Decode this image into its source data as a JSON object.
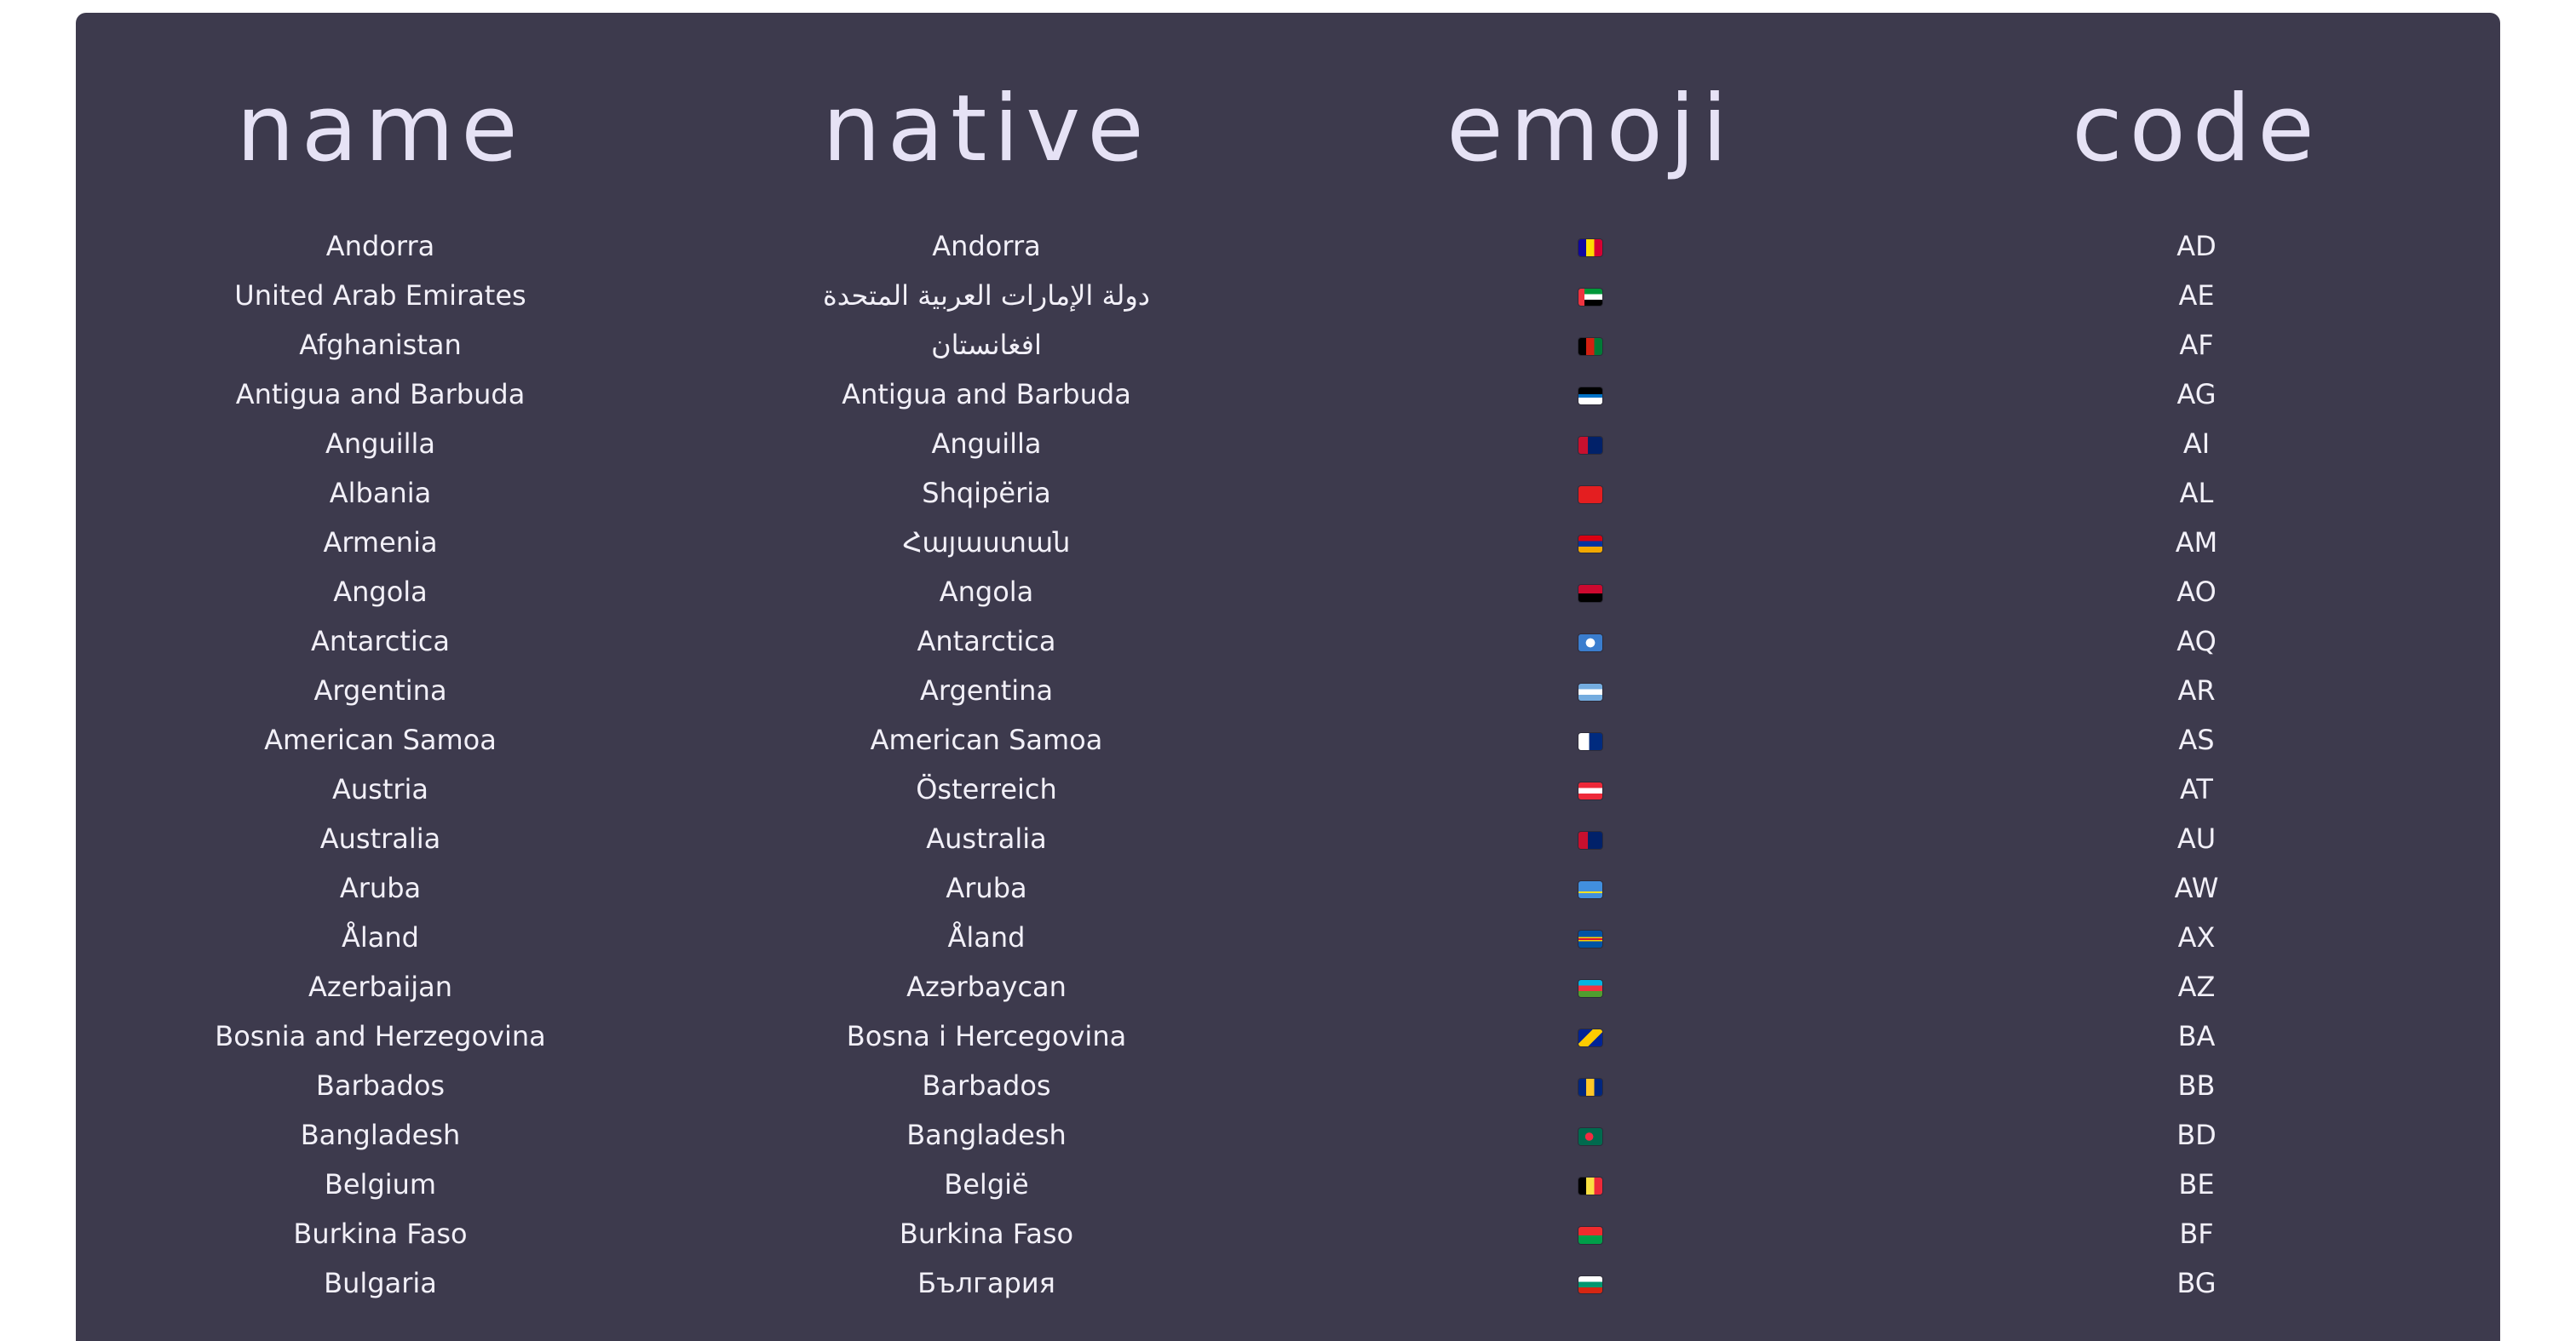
{
  "table": {
    "headers": [
      "name",
      "native",
      "emoji",
      "code"
    ],
    "rows": [
      {
        "name": "Andorra",
        "native": "Andorra",
        "code": "AD",
        "flag": "flag-ad",
        "flag_css": "linear-gradient(90deg,#10069f 33%,#fedd00 33% 66%,#d50032 66%)"
      },
      {
        "name": "United Arab Emirates",
        "native": "دولة الإمارات العربية المتحدة",
        "code": "AE",
        "flag": "flag-ae",
        "flag_css": "linear-gradient(90deg,#ef3340 25%,transparent 25%),linear-gradient(180deg,#009739 33%,#ffffff 33% 66%,#000000 66%)"
      },
      {
        "name": "Afghanistan",
        "native": "افغانستان",
        "code": "AF",
        "flag": "flag-af",
        "flag_css": "linear-gradient(90deg,#000000 33%,#d32011 33% 66%,#007a36 66%)"
      },
      {
        "name": "Antigua and Barbuda",
        "native": "Antigua and Barbuda",
        "code": "AG",
        "flag": "flag-ag",
        "flag_css": "linear-gradient(180deg,#000000 40%,#0072c6 40% 60%,#ffffff 60%)"
      },
      {
        "name": "Anguilla",
        "native": "Anguilla",
        "code": "AI",
        "flag": "flag-ai",
        "flag_css": "linear-gradient(90deg,#c8102e 40%,#012169 40%)"
      },
      {
        "name": "Albania",
        "native": "Shqipëria",
        "code": "AL",
        "flag": "flag-al",
        "flag_css": "linear-gradient(#e41e20,#e41e20)"
      },
      {
        "name": "Armenia",
        "native": "Հայաստան",
        "code": "AM",
        "flag": "flag-am",
        "flag_css": "linear-gradient(180deg,#d90012 33%,#0033a0 33% 66%,#f2a800 66%)"
      },
      {
        "name": "Angola",
        "native": "Angola",
        "code": "AO",
        "flag": "flag-ao",
        "flag_css": "linear-gradient(180deg,#cc092f 50%,#000000 50%)"
      },
      {
        "name": "Antarctica",
        "native": "Antarctica",
        "code": "AQ",
        "flag": "flag-aq",
        "flag_css": "radial-gradient(circle,#ffffff 30%,#3a7dce 32%)"
      },
      {
        "name": "Argentina",
        "native": "Argentina",
        "code": "AR",
        "flag": "flag-ar",
        "flag_css": "linear-gradient(180deg,#74acdf 33%,#ffffff 33% 66%,#74acdf 66%)"
      },
      {
        "name": "American Samoa",
        "native": "American Samoa",
        "code": "AS",
        "flag": "flag-as",
        "flag_css": "linear-gradient(90deg,#ffffff 45%,#002b7f 45%)"
      },
      {
        "name": "Austria",
        "native": "Österreich",
        "code": "AT",
        "flag": "flag-at",
        "flag_css": "linear-gradient(180deg,#ed2939 33%,#ffffff 33% 66%,#ed2939 66%)"
      },
      {
        "name": "Australia",
        "native": "Australia",
        "code": "AU",
        "flag": "flag-au",
        "flag_css": "linear-gradient(90deg,#c8102e 40%,#012169 40%)"
      },
      {
        "name": "Aruba",
        "native": "Aruba",
        "code": "AW",
        "flag": "flag-aw",
        "flag_css": "linear-gradient(180deg,#418fde 60%,#fbe122 60% 70%,#418fde 70%)"
      },
      {
        "name": "Åland",
        "native": "Åland",
        "code": "AX",
        "flag": "flag-ax",
        "flag_css": "linear-gradient(180deg,#0053a5 38%,#ffce00 38% 44%,#d21034 44% 56%,#ffce00 56% 62%,#0053a5 62%)"
      },
      {
        "name": "Azerbaijan",
        "native": "Azərbaycan",
        "code": "AZ",
        "flag": "flag-az",
        "flag_css": "linear-gradient(180deg,#00b5e2 33%,#ef3340 33% 66%,#509e2f 66%)"
      },
      {
        "name": "Bosnia and Herzegovina",
        "native": "Bosna i Hercegovina",
        "code": "BA",
        "flag": "flag-ba",
        "flag_css": "linear-gradient(135deg,#002395 35%,#fecb00 35% 65%,#002395 65%)"
      },
      {
        "name": "Barbados",
        "native": "Barbados",
        "code": "BB",
        "flag": "flag-bb",
        "flag_css": "linear-gradient(90deg,#00267f 33%,#ffc726 33% 66%,#00267f 66%)"
      },
      {
        "name": "Bangladesh",
        "native": "Bangladesh",
        "code": "BD",
        "flag": "flag-bd",
        "flag_css": "radial-gradient(circle at 45% 50%,#f42a41 25%,#006a4e 27%)"
      },
      {
        "name": "Belgium",
        "native": "België",
        "code": "BE",
        "flag": "flag-be",
        "flag_css": "linear-gradient(90deg,#000000 33%,#fae042 33% 66%,#ed2939 66%)"
      },
      {
        "name": "Burkina Faso",
        "native": "Burkina Faso",
        "code": "BF",
        "flag": "flag-bf",
        "flag_css": "linear-gradient(180deg,#ef2b2d 50%,#009e49 50%)"
      },
      {
        "name": "Bulgaria",
        "native": "България",
        "code": "BG",
        "flag": "flag-bg",
        "flag_css": "linear-gradient(180deg,#ffffff 33%,#00966e 33% 66%,#d62612 66%)"
      }
    ]
  }
}
